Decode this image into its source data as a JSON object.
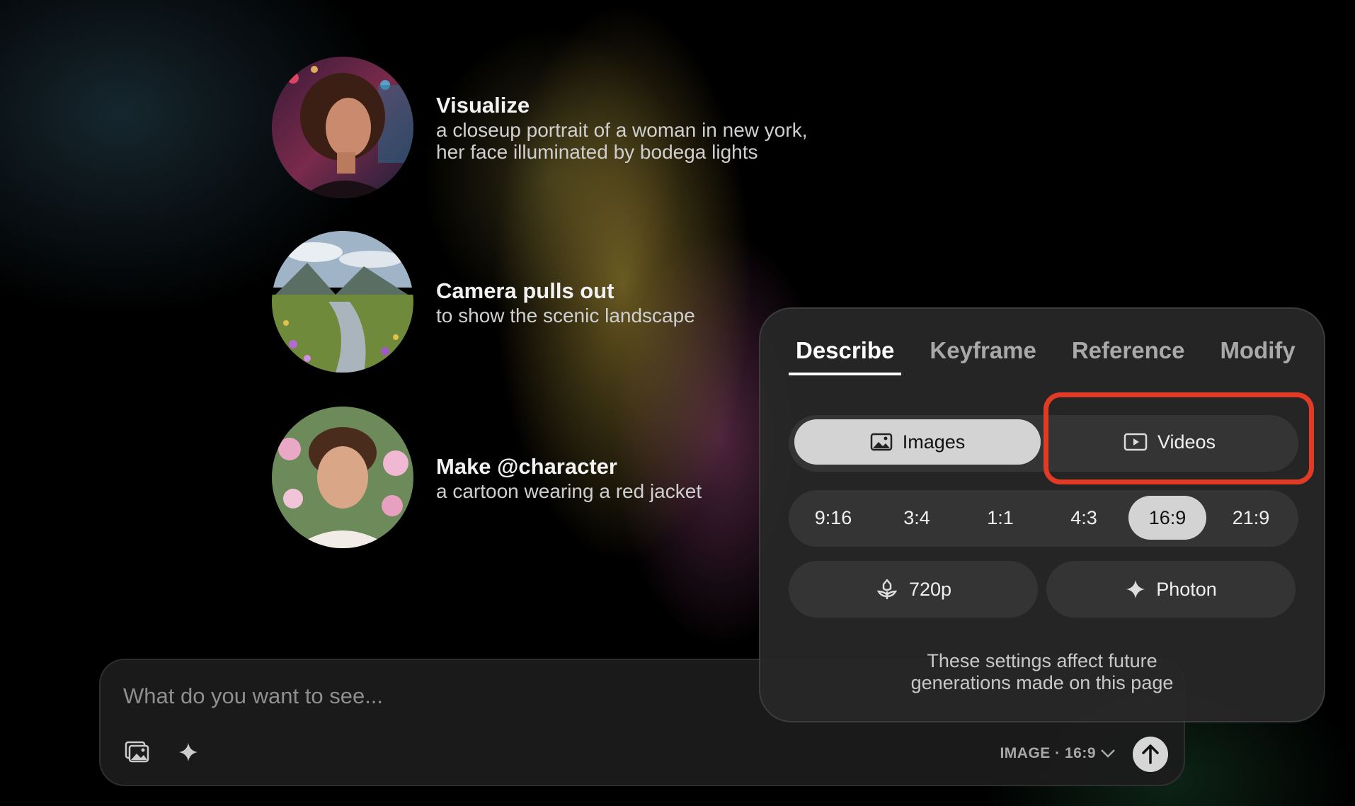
{
  "suggestions": [
    {
      "title": "Visualize",
      "desc_line1": "a closeup portrait of a woman in new york,",
      "desc_line2": "her face illuminated by bodega lights",
      "image": "portrait-woman-city-night"
    },
    {
      "title": "Camera pulls out",
      "desc_line1": "to show the scenic landscape",
      "desc_line2": "",
      "image": "mountain-valley-stream-flowers"
    },
    {
      "title": "Make @character",
      "desc_line1": "a cartoon wearing a red jacket",
      "desc_line2": "",
      "image": "portrait-young-man-flowers"
    }
  ],
  "prompt": {
    "placeholder": "What do you want to see...",
    "value": "",
    "mode_label": "IMAGE · 16:9",
    "icons": [
      "image-upload-icon",
      "sparkle-icon",
      "chevron-down-icon",
      "arrow-up-icon"
    ]
  },
  "settings": {
    "tabs": [
      {
        "label": "Describe",
        "active": true
      },
      {
        "label": "Keyframe",
        "active": false
      },
      {
        "label": "Reference",
        "active": false
      },
      {
        "label": "Modify",
        "active": false
      }
    ],
    "media_types": [
      {
        "label": "Images",
        "selected": true,
        "icon": "image-icon"
      },
      {
        "label": "Videos",
        "selected": false,
        "icon": "video-icon"
      }
    ],
    "aspect_ratios": [
      "9:16",
      "3:4",
      "1:1",
      "4:3",
      "16:9",
      "21:9"
    ],
    "selected_ratio": "16:9",
    "resolution": {
      "label": "720p",
      "icon": "flower-icon"
    },
    "model": {
      "label": "Photon",
      "icon": "sparkle-icon"
    },
    "note_line1": "These settings affect future",
    "note_line2": "generations made on this page"
  },
  "colors": {
    "highlight": "#e13b26",
    "selected_bg": "#d3d3d3",
    "panel_bg": "#282828"
  }
}
